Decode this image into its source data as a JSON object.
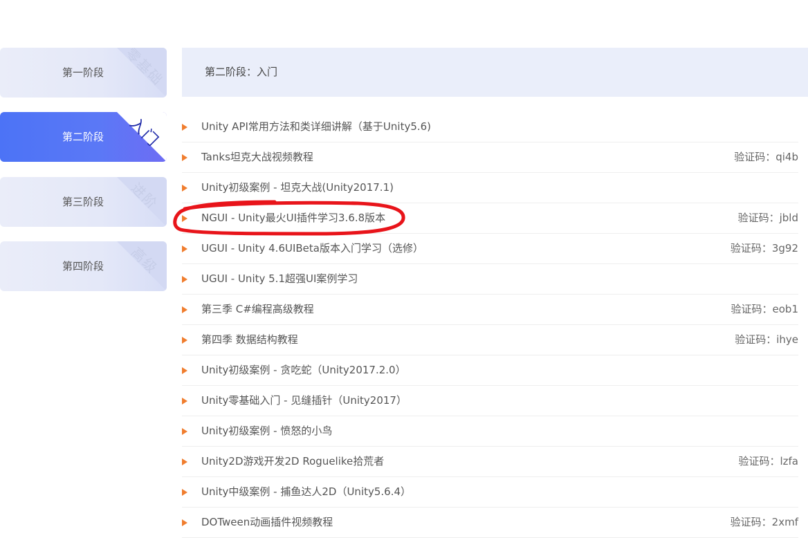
{
  "stages": [
    {
      "label": "第一阶段",
      "badge": "零基础",
      "active": false
    },
    {
      "label": "第二阶段",
      "badge": "入门",
      "active": true
    },
    {
      "label": "第三阶段",
      "badge": "进阶",
      "active": false
    },
    {
      "label": "第四阶段",
      "badge": "高级",
      "active": false
    }
  ],
  "header": {
    "title": "第二阶段：入门"
  },
  "courses": [
    {
      "title": "Unity API常用方法和类详细讲解（基于Unity5.6)",
      "code": ""
    },
    {
      "title": "Tanks坦克大战视频教程",
      "code": "验证码：qi4b"
    },
    {
      "title": "Unity初级案例 - 坦克大战(Unity2017.1)",
      "code": ""
    },
    {
      "title": "NGUI - Unity最火UI插件学习3.6.8版本",
      "code": "验证码：jbld"
    },
    {
      "title": "UGUI - Unity 4.6UIBeta版本入门学习（选修）",
      "code": "验证码：3g92"
    },
    {
      "title": "UGUI - Unity 5.1超强UI案例学习",
      "code": ""
    },
    {
      "title": "第三季 C#编程高级教程",
      "code": "验证码：eob1"
    },
    {
      "title": "第四季 数据结构教程",
      "code": "验证码：ihye"
    },
    {
      "title": "Unity初级案例 - 贪吃蛇（Unity2017.2.0）",
      "code": ""
    },
    {
      "title": "Unity零基础入门 - 见缝插针（Unity2017）",
      "code": ""
    },
    {
      "title": "Unity初级案例 - 愤怒的小鸟",
      "code": ""
    },
    {
      "title": "Unity2D游戏开发2D Roguelike拾荒者",
      "code": "验证码：lzfa"
    },
    {
      "title": "Unity中级案例 - 捕鱼达人2D（Unity5.6.4）",
      "code": ""
    },
    {
      "title": "DOTween动画插件视频教程",
      "code": "验证码：2xmf"
    }
  ],
  "colors": {
    "active_tab": "#4c73f6",
    "inactive_tab": "#e6e9f8",
    "header_bg": "#eaeefa",
    "arrow": "#f07d2e",
    "annotation": "#e8141a"
  },
  "icons": {
    "row_marker": "play-triangle-icon"
  }
}
